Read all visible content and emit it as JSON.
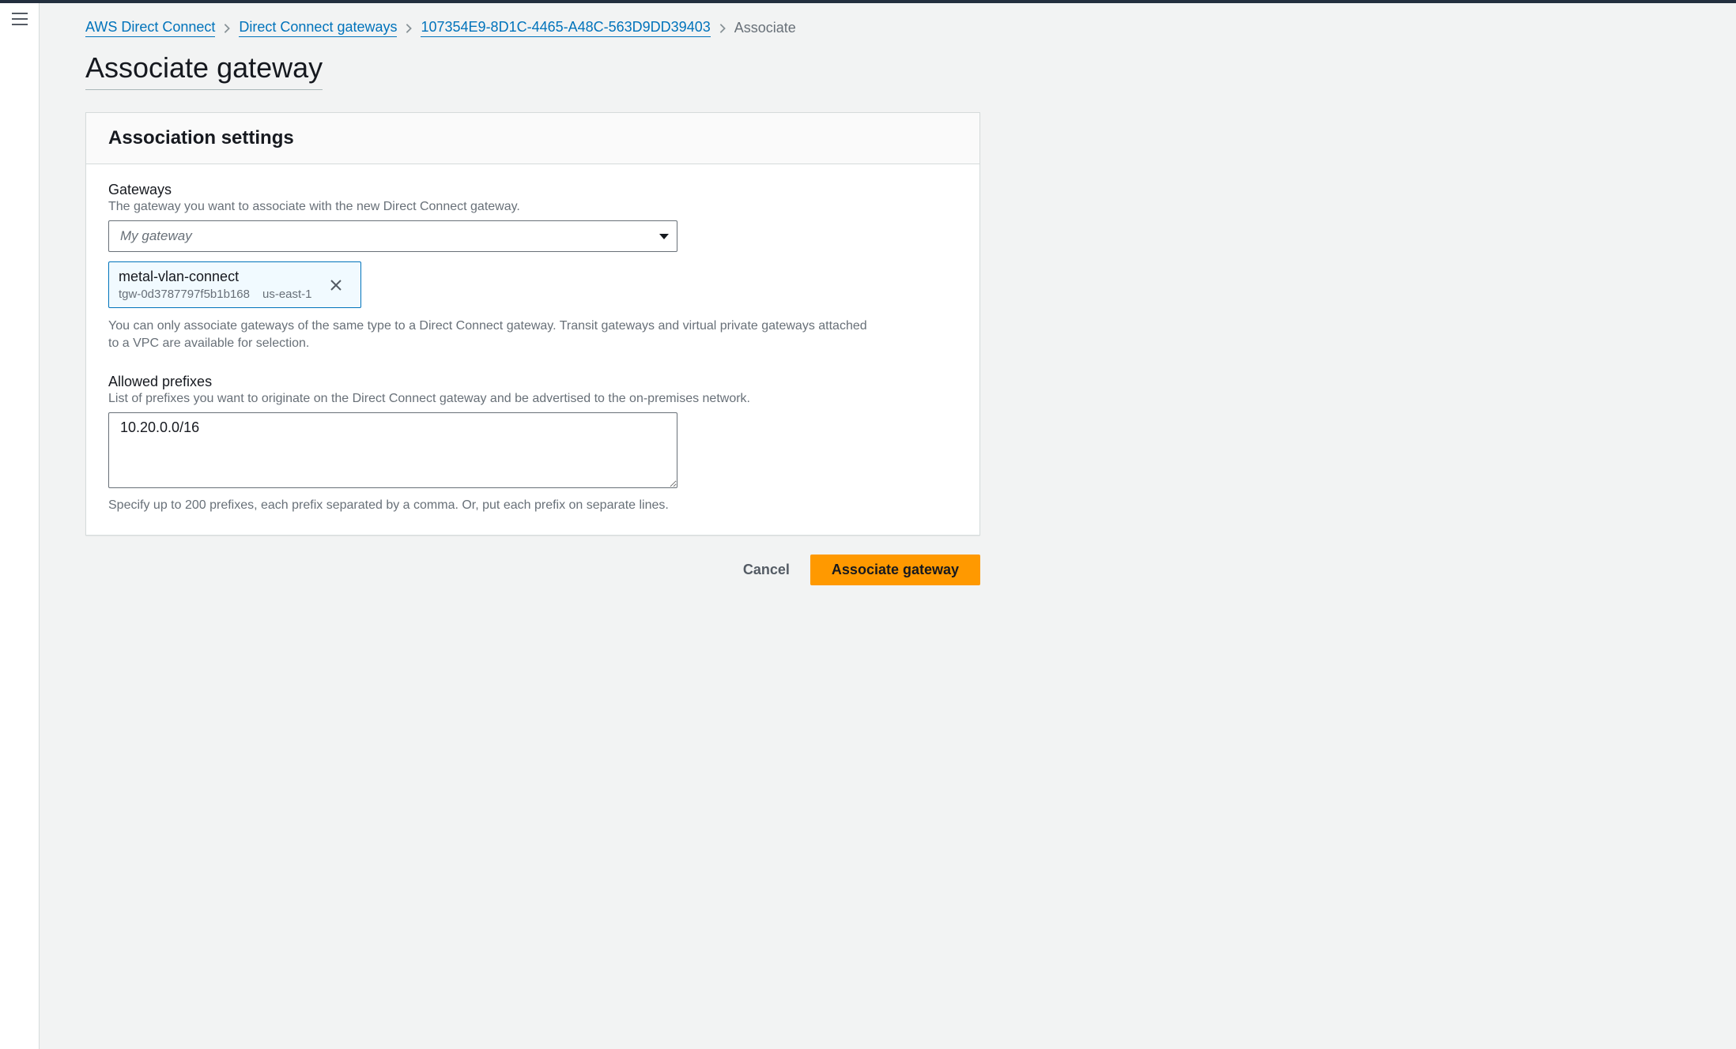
{
  "breadcrumbs": {
    "items": [
      {
        "label": "AWS Direct Connect"
      },
      {
        "label": "Direct Connect gateways"
      },
      {
        "label": "107354E9-8D1C-4465-A48C-563D9DD39403"
      }
    ],
    "current": "Associate"
  },
  "page": {
    "title": "Associate gateway"
  },
  "panel": {
    "title": "Association settings"
  },
  "gateways": {
    "label": "Gateways",
    "description": "The gateway you want to associate with the new Direct Connect gateway.",
    "placeholder": "My gateway",
    "selected": {
      "name": "metal-vlan-connect",
      "id": "tgw-0d3787797f5b1b168",
      "region": "us-east-1"
    },
    "hint": "You can only associate gateways of the same type to a Direct Connect gateway. Transit gateways and virtual private gateways attached to a VPC are available for selection."
  },
  "prefixes": {
    "label": "Allowed prefixes",
    "description": "List of prefixes you want to originate on the Direct Connect gateway and be advertised to the on-premises network.",
    "value": "10.20.0.0/16",
    "hint": "Specify up to 200 prefixes, each prefix separated by a comma. Or, put each prefix on separate lines."
  },
  "actions": {
    "cancel": "Cancel",
    "submit": "Associate gateway"
  }
}
